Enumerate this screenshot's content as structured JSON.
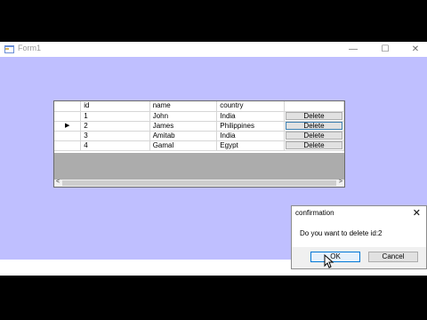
{
  "window": {
    "title": "Form1",
    "minimize_glyph": "—",
    "maximize_glyph": "☐",
    "close_glyph": "✕"
  },
  "grid": {
    "headers": [
      "id",
      "name",
      "country",
      ""
    ],
    "current_row_glyph": "▶",
    "rows": [
      {
        "id": "1",
        "name": "John",
        "country": "India",
        "action": "Delete"
      },
      {
        "id": "2",
        "name": "James",
        "country": "Philippines",
        "action": "Delete"
      },
      {
        "id": "3",
        "name": "Amitab",
        "country": "India",
        "action": "Delete"
      },
      {
        "id": "4",
        "name": "Gamal",
        "country": "Egypt",
        "action": "Delete"
      }
    ],
    "scroll_left_glyph": "<",
    "scroll_right_glyph": ">"
  },
  "dialog": {
    "title": "confirmation",
    "close_glyph": "✕",
    "message": "Do you want to delete id:2",
    "ok_label": "OK",
    "cancel_label": "Cancel"
  },
  "colors": {
    "form_background": "#bfbfff",
    "grid_empty_area": "#acacac",
    "accent": "#0078d7"
  },
  "icons": {
    "app": "form-app-icon",
    "cursor": "mouse-pointer-icon"
  }
}
